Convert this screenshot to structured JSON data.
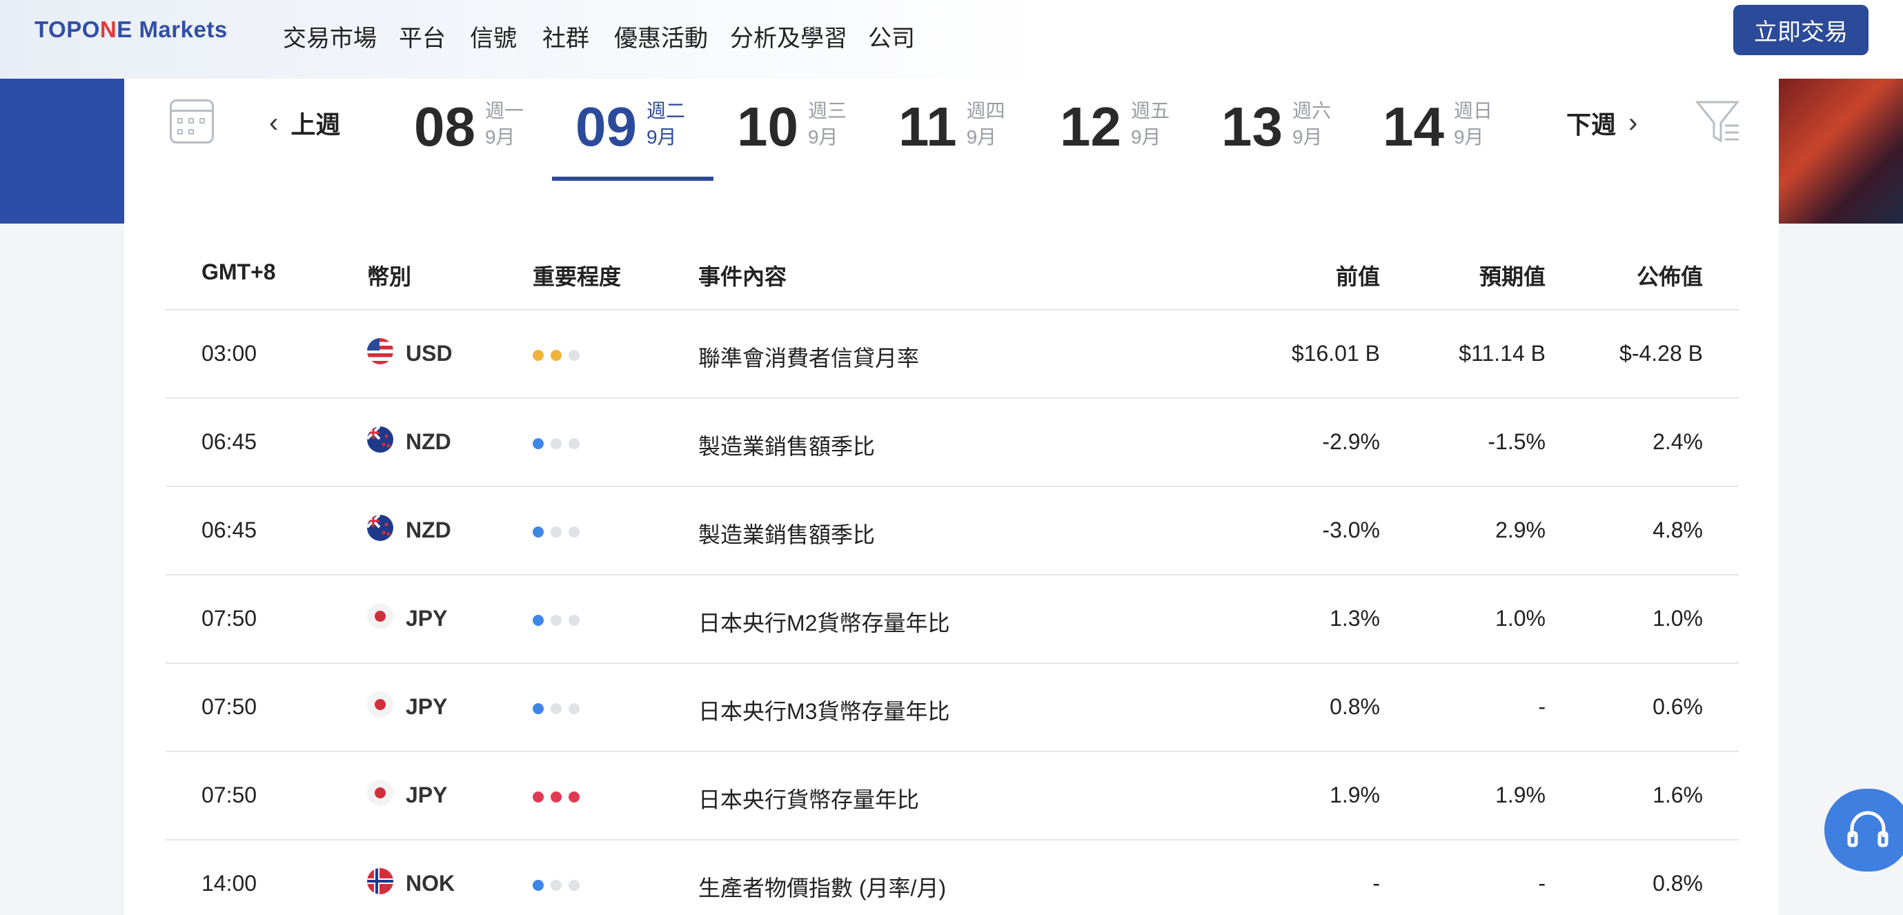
{
  "header": {
    "logo": {
      "part1": "TOP",
      "part2": "O",
      "part3": "N",
      "part4": "E Markets"
    },
    "nav": [
      "交易市場",
      "平台",
      "信號",
      "社群",
      "優惠活動",
      "分析及學習",
      "公司"
    ],
    "cta": "立即交易"
  },
  "calendar": {
    "prev_week": "上週",
    "next_week": "下週",
    "days": [
      {
        "num": "08",
        "weekday": "週一",
        "month": "9月"
      },
      {
        "num": "09",
        "weekday": "週二",
        "month": "9月"
      },
      {
        "num": "10",
        "weekday": "週三",
        "month": "9月"
      },
      {
        "num": "11",
        "weekday": "週四",
        "month": "9月"
      },
      {
        "num": "12",
        "weekday": "週五",
        "month": "9月"
      },
      {
        "num": "13",
        "weekday": "週六",
        "month": "9月"
      },
      {
        "num": "14",
        "weekday": "週日",
        "month": "9月"
      }
    ],
    "active_index": 1
  },
  "table": {
    "headers": {
      "time": "GMT+8",
      "currency": "幣別",
      "importance": "重要程度",
      "event": "事件內容",
      "previous": "前值",
      "forecast": "預期值",
      "actual": "公佈值"
    },
    "rows": [
      {
        "time": "03:00",
        "currency": "USD",
        "importance": 2,
        "importance_color": "#f2b33d",
        "event": "聯準會消費者信貸月率",
        "previous": "$16.01 B",
        "forecast": "$11.14 B",
        "actual": "$-4.28 B"
      },
      {
        "time": "06:45",
        "currency": "NZD",
        "importance": 1,
        "importance_color": "#3f86e8",
        "event": "製造業銷售額季比",
        "previous": "-2.9%",
        "forecast": "-1.5%",
        "actual": "2.4%"
      },
      {
        "time": "06:45",
        "currency": "NZD",
        "importance": 1,
        "importance_color": "#3f86e8",
        "event": "製造業銷售額季比",
        "previous": "-3.0%",
        "forecast": "2.9%",
        "actual": "4.8%"
      },
      {
        "time": "07:50",
        "currency": "JPY",
        "importance": 1,
        "importance_color": "#3f86e8",
        "event": "日本央行M2貨幣存量年比",
        "previous": "1.3%",
        "forecast": "1.0%",
        "actual": "1.0%"
      },
      {
        "time": "07:50",
        "currency": "JPY",
        "importance": 1,
        "importance_color": "#3f86e8",
        "event": "日本央行M3貨幣存量年比",
        "previous": "0.8%",
        "forecast": "-",
        "actual": "0.6%"
      },
      {
        "time": "07:50",
        "currency": "JPY",
        "importance": 3,
        "importance_color": "#e23a55",
        "event": "日本央行貨幣存量年比",
        "previous": "1.9%",
        "forecast": "1.9%",
        "actual": "1.6%"
      },
      {
        "time": "14:00",
        "currency": "NOK",
        "importance": 1,
        "importance_color": "#3f86e8",
        "event": "生產者物價指數 (月率/月)",
        "previous": "-",
        "forecast": "-",
        "actual": "0.8%"
      }
    ]
  },
  "colors": {
    "brand": "#2c4a9a",
    "accent": "#e23a3a",
    "help": "#3f7fe0"
  },
  "icons": {
    "calendar": "calendar-grid-icon",
    "filter": "filter-icon",
    "help": "headset-icon",
    "prev": "chevron-left-icon",
    "next": "chevron-right-icon"
  }
}
